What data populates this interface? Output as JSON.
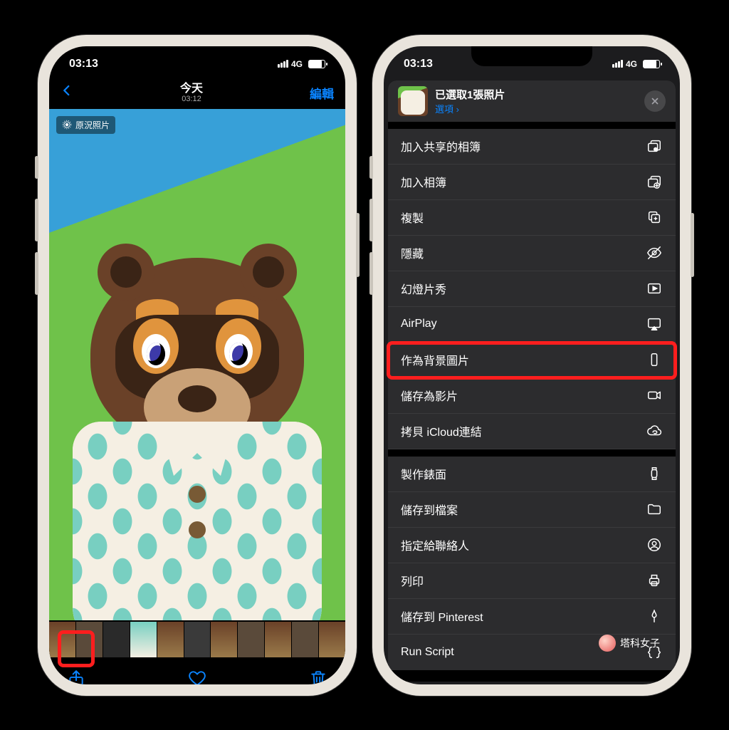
{
  "status": {
    "time": "03:13",
    "network": "4G"
  },
  "left": {
    "nav": {
      "title": "今天",
      "subtitle": "03:12",
      "edit": "編輯"
    },
    "live_badge": "原況照片"
  },
  "right": {
    "header": {
      "title": "已選取1張照片",
      "subtitle": "選項 ›"
    },
    "actions": [
      {
        "id": "add-shared-album",
        "label": "加入共享的相簿",
        "icon": "shared-album"
      },
      {
        "id": "add-album",
        "label": "加入相簿",
        "icon": "album-plus"
      },
      {
        "id": "copy",
        "label": "複製",
        "icon": "copy"
      },
      {
        "id": "hide",
        "label": "隱藏",
        "icon": "eye-off"
      },
      {
        "id": "slideshow",
        "label": "幻燈片秀",
        "icon": "play-rect"
      },
      {
        "id": "airplay",
        "label": "AirPlay",
        "icon": "airplay"
      },
      {
        "id": "wallpaper",
        "label": "作為背景圖片",
        "icon": "phone-rect",
        "highlight": true
      },
      {
        "id": "save-video",
        "label": "儲存為影片",
        "icon": "video"
      },
      {
        "id": "icloud-link",
        "label": "拷貝 iCloud連結",
        "icon": "cloud-link"
      },
      {
        "id": "watch-face",
        "label": "製作錶面",
        "icon": "watch",
        "group": 2
      },
      {
        "id": "save-file",
        "label": "儲存到檔案",
        "icon": "folder",
        "group": 2
      },
      {
        "id": "assign-contact",
        "label": "指定給聯絡人",
        "icon": "contact",
        "group": 2
      },
      {
        "id": "print",
        "label": "列印",
        "icon": "printer",
        "group": 2
      },
      {
        "id": "save-pinterest",
        "label": "儲存到 Pinterest",
        "icon": "pin",
        "group": 2
      },
      {
        "id": "run-script",
        "label": "Run Script",
        "icon": "braces",
        "group": 2
      }
    ]
  },
  "watermark": "塔科女子"
}
